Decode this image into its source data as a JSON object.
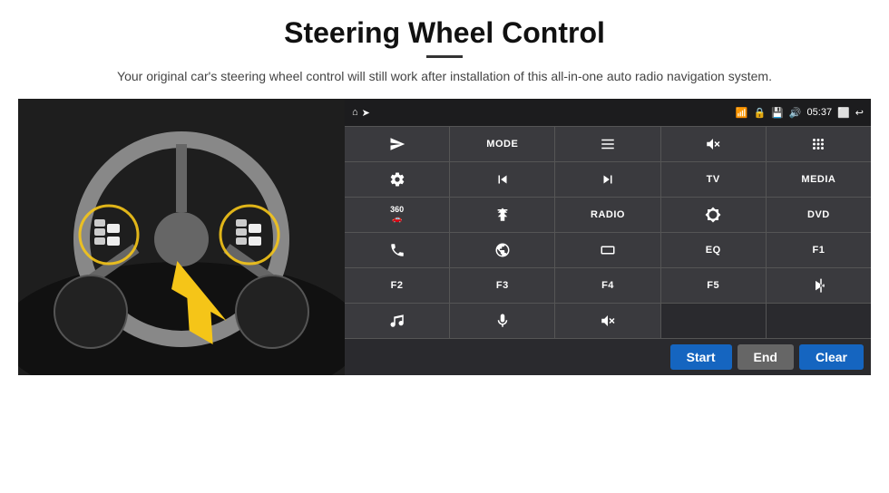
{
  "header": {
    "title": "Steering Wheel Control",
    "subtitle": "Your original car's steering wheel control will still work after installation of this all-in-one auto radio navigation system."
  },
  "status_bar": {
    "time": "05:37",
    "home_icon": "⌂",
    "wifi_icon": "wifi",
    "lock_icon": "🔒",
    "sd_icon": "sd",
    "bt_icon": "🔊",
    "back_icon": "↩",
    "screen_icon": "⬜"
  },
  "buttons": [
    {
      "id": "row1",
      "cells": [
        {
          "label": "",
          "icon": "send",
          "type": "icon"
        },
        {
          "label": "MODE",
          "type": "text"
        },
        {
          "label": "",
          "icon": "list",
          "type": "icon"
        },
        {
          "label": "",
          "icon": "mute",
          "type": "icon"
        },
        {
          "label": "",
          "icon": "grid",
          "type": "icon"
        }
      ]
    },
    {
      "id": "row2",
      "cells": [
        {
          "label": "",
          "icon": "settings",
          "type": "icon"
        },
        {
          "label": "",
          "icon": "prev",
          "type": "icon"
        },
        {
          "label": "",
          "icon": "next",
          "type": "icon"
        },
        {
          "label": "TV",
          "type": "text"
        },
        {
          "label": "MEDIA",
          "type": "text"
        }
      ]
    },
    {
      "id": "row3",
      "cells": [
        {
          "label": "",
          "icon": "360cam",
          "type": "icon"
        },
        {
          "label": "",
          "icon": "eject",
          "type": "icon"
        },
        {
          "label": "RADIO",
          "type": "text"
        },
        {
          "label": "",
          "icon": "brightness",
          "type": "icon"
        },
        {
          "label": "DVD",
          "type": "text"
        }
      ]
    },
    {
      "id": "row4",
      "cells": [
        {
          "label": "",
          "icon": "phone",
          "type": "icon"
        },
        {
          "label": "",
          "icon": "globe",
          "type": "icon"
        },
        {
          "label": "",
          "icon": "rectangle",
          "type": "icon"
        },
        {
          "label": "EQ",
          "type": "text"
        },
        {
          "label": "F1",
          "type": "text"
        }
      ]
    },
    {
      "id": "row5",
      "cells": [
        {
          "label": "F2",
          "type": "text"
        },
        {
          "label": "F3",
          "type": "text"
        },
        {
          "label": "F4",
          "type": "text"
        },
        {
          "label": "F5",
          "type": "text"
        },
        {
          "label": "",
          "icon": "playpause",
          "type": "icon"
        }
      ]
    },
    {
      "id": "row6",
      "cells": [
        {
          "label": "",
          "icon": "music",
          "type": "icon"
        },
        {
          "label": "",
          "icon": "mic",
          "type": "icon"
        },
        {
          "label": "",
          "icon": "volhangup",
          "type": "icon"
        },
        {
          "label": "",
          "type": "empty"
        },
        {
          "label": "",
          "type": "empty"
        }
      ]
    }
  ],
  "bottom_buttons": {
    "start": "Start",
    "end": "End",
    "clear": "Clear"
  }
}
